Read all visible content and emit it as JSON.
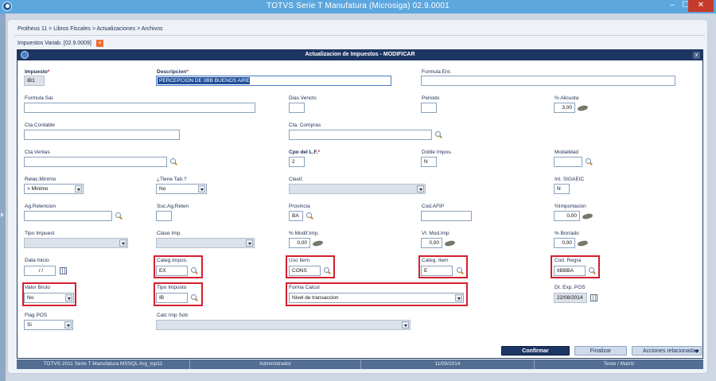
{
  "window": {
    "title": "TOTVS Serie T Manufatura (Microsiga) 02.9.0001",
    "minimize": "–",
    "maximize": "☐",
    "close": "✕"
  },
  "breadcrumb": "Protheus 11 > Libros Fiscales > Actualizaciones > Archivos",
  "tab": {
    "label": "Impuestos Variab. [02.9.0009]",
    "close": "×"
  },
  "dialog": {
    "title": "Actualizacion de Impuestos - MODIFICAR",
    "close": "x"
  },
  "fields": {
    "impuesto": {
      "label": "Impuesto",
      "req": "*",
      "value": "IB1"
    },
    "descripcion": {
      "label": "Descripcion",
      "req": "*",
      "value": "PERCEPCION DE IIBB BUENOS AIRE"
    },
    "formula_ent": {
      "label": "Formula Ent.",
      "value": ""
    },
    "formula_sal": {
      "label": "Formula Sal.",
      "value": ""
    },
    "dias_vencto": {
      "label": "Dias Vencto",
      "value": ""
    },
    "periodo": {
      "label": "Periodo",
      "value": ""
    },
    "alicuota": {
      "label": "% Alicuota",
      "value": "3,00"
    },
    "cta_contable": {
      "label": "Cta.Contable",
      "value": ""
    },
    "cta_compras": {
      "label": "Cta. Compras",
      "value": ""
    },
    "cta_ventas": {
      "label": "Cta.Ventas",
      "value": ""
    },
    "cpo_lf": {
      "label": "Cpo del L.F.",
      "req": "*",
      "value": "2"
    },
    "doble_impos": {
      "label": "Doble Impos.",
      "value": "N"
    },
    "modalidad": {
      "label": "Modalidad",
      "value": ""
    },
    "relac_minimo": {
      "label": "Relac.Minimo",
      "value": "> Minimo"
    },
    "tiene_tab": {
      "label": "¿Tiene Tab.?",
      "value": "No"
    },
    "clasif": {
      "label": "Clasif.",
      "value": ""
    },
    "int_sigaeic": {
      "label": "Int. SIGAEIC",
      "value": "N"
    },
    "ag_retencion": {
      "label": "Ag.Retencion",
      "value": ""
    },
    "suc_ag_reten": {
      "label": "Suc.Ag.Reten",
      "value": ""
    },
    "provincia": {
      "label": "Provincia",
      "value": "BA"
    },
    "cod_afip": {
      "label": "Cod.AFIP",
      "value": ""
    },
    "importacion": {
      "label": "%Importacion",
      "value": "0,00"
    },
    "tipo_impuest": {
      "label": "Tipo Impuest",
      "value": ""
    },
    "clase_imp": {
      "label": "Clase Imp.",
      "value": ""
    },
    "modif_imp": {
      "label": "% Modif.Imp.",
      "value": "0,00"
    },
    "vl_mod_imp": {
      "label": "Vl. Mod.Imp",
      "value": "0,00"
    },
    "borrado": {
      "label": "% Borrado",
      "value": "0,00"
    },
    "data_inicio": {
      "label": "Data Inicio",
      "value": "/ /"
    },
    "categ_impos": {
      "label": "Categ.Impos.",
      "value": "EX"
    },
    "uso_item": {
      "label": "Uso Item",
      "value": "CONS"
    },
    "categ_item": {
      "label": "Categ. Item",
      "value": "E"
    },
    "cod_regra": {
      "label": "Cod. Regra",
      "value": "IIBBBA"
    },
    "valor_bruto": {
      "label": "Valor Bruto",
      "value": "No"
    },
    "tipo_imposto": {
      "label": "Tipo Imposto",
      "value": "IB"
    },
    "forma_calcul": {
      "label": "Forma Calcul",
      "value": "Nivel de transaccion"
    },
    "dt_exp_pos": {
      "label": "Dt. Exp. POS",
      "value": "22/08/2014"
    },
    "flag_pos": {
      "label": "Flag POS",
      "value": "Si"
    },
    "calc_imp_sob": {
      "label": "Calc Imp Sob",
      "value": ""
    }
  },
  "buttons": {
    "confirmar": "Confirmar",
    "finalizar": "Finalizar",
    "acciones": "Acciones relacionadas"
  },
  "status": [
    "TOTVS 2011 Serie T Manufatura MSSQL Arg_top11",
    "Administrador",
    "11/09/2014",
    "Teste / Matriz"
  ],
  "colors": {
    "highlight": "#d3202e",
    "titlebar": "#5da7df",
    "dialog_bar": "#1d3563"
  }
}
